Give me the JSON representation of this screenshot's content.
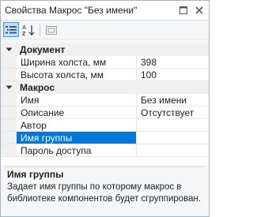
{
  "window": {
    "title": "Свойства Макрос \"Без имени\""
  },
  "toolbar": {
    "categorized_icon": "categorized-icon",
    "alphabetical_icon": "sort-az-icon",
    "property_pages_icon": "property-pages-icon"
  },
  "grid": {
    "categories": [
      {
        "label": "Документ",
        "properties": [
          {
            "name": "Ширина холста, мм",
            "value": "398"
          },
          {
            "name": "Высота холста, мм",
            "value": "100"
          }
        ]
      },
      {
        "label": "Макрос",
        "properties": [
          {
            "name": "Имя",
            "value": "Без имени"
          },
          {
            "name": "Описание",
            "value": "Отсутствует"
          },
          {
            "name": "Автор",
            "value": ""
          },
          {
            "name": "Имя группы",
            "value": ""
          },
          {
            "name": "Пароль доступа",
            "value": ""
          }
        ]
      }
    ]
  },
  "description": {
    "title": "Имя группы",
    "text": "Задает имя группы по которому макрос в библиотеке компонентов будет сгруппирован."
  },
  "colors": {
    "selection": "#0078d7",
    "accent": "#3399ff"
  }
}
